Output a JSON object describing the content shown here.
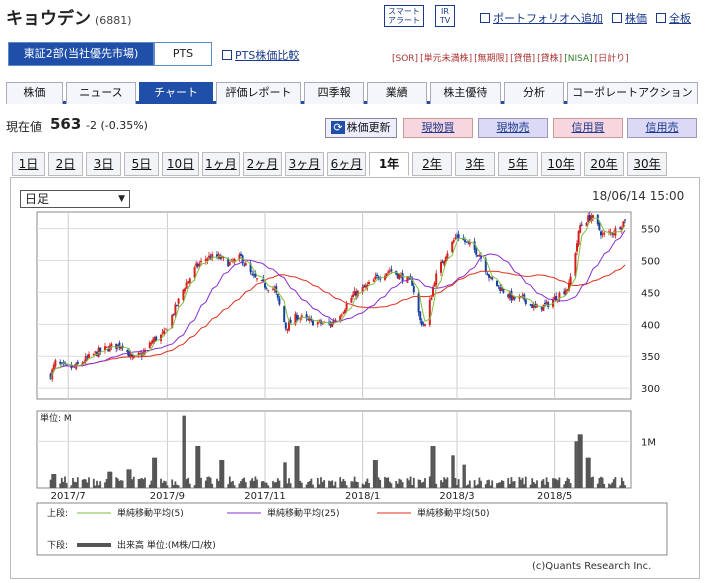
{
  "header": {
    "name": "キョウデン",
    "code": "(6881)",
    "smart_alert": "スマート アラート",
    "ir": "IR TV",
    "portfolio": "ポートフォリオへ追加",
    "stock_price": "株価",
    "board": "全板"
  },
  "market": {
    "primary": "東証2部(当社優先市場)",
    "pts": "PTS",
    "pts_compare": "PTS株価比較"
  },
  "badges": [
    "[SOR]",
    "[単元未満株]",
    "[無期限]",
    "[貸借]",
    "[貸株]",
    "[NISA]",
    "[日計り]"
  ],
  "tabs": [
    "株価",
    "ニュース",
    "チャート",
    "評価レポート",
    "四季報",
    "業績",
    "株主優待",
    "分析",
    "コーポレートアクション"
  ],
  "active_tab": "チャート",
  "quote": {
    "label": "現在値",
    "price": "563",
    "change": "-2 (-0.35%)",
    "refresh": "株価更新",
    "buy": "現物買",
    "sell": "現物売",
    "margin_buy": "信用買",
    "margin_sell": "信用売"
  },
  "periods": [
    "1日",
    "2日",
    "3日",
    "5日",
    "10日",
    "1ヶ月",
    "2ヶ月",
    "3ヶ月",
    "6ヶ月",
    "1年",
    "2年",
    "3年",
    "5年",
    "10年",
    "20年",
    "30年"
  ],
  "active_period": "1年",
  "chart_type_select": "日足",
  "timestamp": "18/06/14 15:00",
  "copyright": "(c)Quants Research Inc.",
  "colors": {
    "up": "#d62020",
    "down": "#1b3fa0",
    "ma5": "#7fbf3f",
    "ma25": "#8b2fd0",
    "ma50": "#e0301e",
    "volume": "#555555",
    "tab_active": "#1f4fa8"
  },
  "chart_data": {
    "type": "candlestick",
    "price_axis": {
      "ticks": [
        550,
        500,
        450,
        400,
        350,
        300
      ],
      "ylim": [
        283,
        576
      ]
    },
    "volume_axis": {
      "unit_label": "単位: M",
      "ticks": [
        {
          "value": 1,
          "label": "1M"
        }
      ],
      "ylim": [
        0,
        1.65
      ]
    },
    "x_tick_labels": [
      "2017/7",
      "2017/9",
      "2017/11",
      "2018/1",
      "2018/3",
      "2018/5"
    ],
    "close_series_approx": [
      [
        "2017-06-20",
        320
      ],
      [
        "2017-06-23",
        340
      ],
      [
        "2017-06-28",
        333
      ],
      [
        "2017-07-05",
        332
      ],
      [
        "2017-07-12",
        345
      ],
      [
        "2017-07-20",
        357
      ],
      [
        "2017-07-28",
        365
      ],
      [
        "2017-08-04",
        368
      ],
      [
        "2017-08-10",
        345
      ],
      [
        "2017-08-17",
        355
      ],
      [
        "2017-08-23",
        375
      ],
      [
        "2017-08-30",
        385
      ],
      [
        "2017-09-06",
        425
      ],
      [
        "2017-09-12",
        460
      ],
      [
        "2017-09-19",
        490
      ],
      [
        "2017-09-26",
        505
      ],
      [
        "2017-10-03",
        505
      ],
      [
        "2017-10-10",
        495
      ],
      [
        "2017-10-17",
        505
      ],
      [
        "2017-10-24",
        475
      ],
      [
        "2017-10-31",
        462
      ],
      [
        "2017-11-07",
        455
      ],
      [
        "2017-11-14",
        395
      ],
      [
        "2017-11-21",
        413
      ],
      [
        "2017-11-28",
        405
      ],
      [
        "2017-12-05",
        402
      ],
      [
        "2017-12-12",
        400
      ],
      [
        "2017-12-19",
        420
      ],
      [
        "2017-12-26",
        445
      ],
      [
        "2018-01-04",
        460
      ],
      [
        "2018-01-11",
        475
      ],
      [
        "2018-01-18",
        485
      ],
      [
        "2018-01-25",
        475
      ],
      [
        "2018-02-01",
        465
      ],
      [
        "2018-02-06",
        405
      ],
      [
        "2018-02-09",
        398
      ],
      [
        "2018-02-15",
        470
      ],
      [
        "2018-02-22",
        510
      ],
      [
        "2018-03-01",
        540
      ],
      [
        "2018-03-08",
        525
      ],
      [
        "2018-03-15",
        510
      ],
      [
        "2018-03-22",
        470
      ],
      [
        "2018-03-29",
        455
      ],
      [
        "2018-04-05",
        440
      ],
      [
        "2018-04-12",
        440
      ],
      [
        "2018-04-19",
        425
      ],
      [
        "2018-04-26",
        430
      ],
      [
        "2018-05-03",
        445
      ],
      [
        "2018-05-10",
        460
      ],
      [
        "2018-05-17",
        555
      ],
      [
        "2018-05-24",
        570
      ],
      [
        "2018-05-31",
        540
      ],
      [
        "2018-06-07",
        545
      ],
      [
        "2018-06-14",
        563
      ]
    ],
    "volume_spikes_M": [
      [
        "2017-06-22",
        0.3
      ],
      [
        "2017-07-27",
        0.35
      ],
      [
        "2017-08-08",
        0.4
      ],
      [
        "2017-08-24",
        0.65
      ],
      [
        "2017-09-11",
        1.55
      ],
      [
        "2017-09-20",
        0.9
      ],
      [
        "2017-10-05",
        0.6
      ],
      [
        "2017-11-13",
        0.55
      ],
      [
        "2017-11-21",
        0.9
      ],
      [
        "2018-01-09",
        0.6
      ],
      [
        "2018-02-14",
        0.9
      ],
      [
        "2018-02-26",
        0.7
      ],
      [
        "2018-03-05",
        0.5
      ],
      [
        "2018-05-15",
        1.0
      ],
      [
        "2018-05-17",
        1.15
      ],
      [
        "2018-05-22",
        0.65
      ]
    ],
    "series": [
      {
        "name": "単純移動平均(5)",
        "period": 5
      },
      {
        "name": "単純移動平均(25)",
        "period": 25
      },
      {
        "name": "単純移動平均(50)",
        "period": 50
      },
      {
        "name": "出来高 単位:(M株/口/枚)"
      }
    ],
    "legend_prefix": {
      "upper": "上段:",
      "lower": "下段:"
    }
  }
}
